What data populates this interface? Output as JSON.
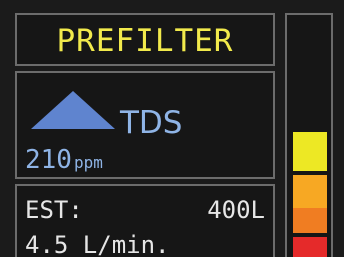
{
  "header": {
    "title": "PREFILTER"
  },
  "tds": {
    "trend_icon": "triangle-up-icon",
    "label": "TDS",
    "value": "210",
    "unit": "ppm"
  },
  "estimate": {
    "label": "EST:",
    "volume": "400L",
    "flow_rate": "4.5 L/min."
  },
  "level_meter": {
    "segment_colors": [
      "#ede824",
      "#f7a823",
      "#f07d22",
      "#e52a2a"
    ]
  },
  "colors": {
    "title": "#f2ea4c",
    "tds": "#8fb4e6",
    "trend_icon": "#5f84cf",
    "text": "#e6e6e6",
    "border": "#6c6c6c"
  }
}
